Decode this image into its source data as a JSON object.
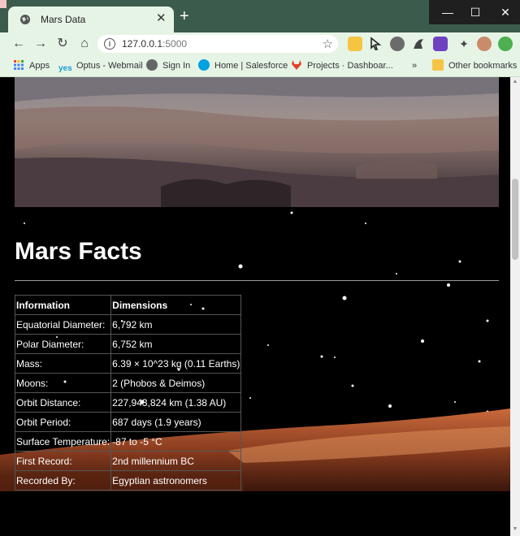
{
  "browser": {
    "tab_title": "Mars Data",
    "tab_close": "✕",
    "new_tab": "+",
    "window_controls": [
      "—",
      "☐",
      "✕"
    ],
    "url_host": "127.0.0.1",
    "url_port": ":5000",
    "bookmarks": [
      {
        "label": "Apps",
        "icon": "apps-grid-icon",
        "color": "#4285f4"
      },
      {
        "label": "Optus - Webmail",
        "icon": "optus-icon",
        "color": "#1a9bd7"
      },
      {
        "label": "Sign In",
        "icon": "globe-icon",
        "color": "#555555"
      },
      {
        "label": "Home | Salesforce",
        "icon": "salesforce-cloud-icon",
        "color": "#00a1e0"
      },
      {
        "label": "Projects · Dashboar...",
        "icon": "gitlab-fox-icon",
        "color": "#e24329"
      }
    ],
    "bookmarks_overflow": "»",
    "other_bookmarks": "Other bookmarks"
  },
  "page": {
    "heading": "Mars Facts",
    "table": {
      "headers": [
        "Information",
        "Dimensions"
      ],
      "rows": [
        [
          "Equatorial Diameter:",
          "6,792 km"
        ],
        [
          "Polar Diameter:",
          "6,752 km"
        ],
        [
          "Mass:",
          "6.39 × 10^23 kg (0.11 Earths)"
        ],
        [
          "Moons:",
          "2 (Phobos & Deimos)"
        ],
        [
          "Orbit Distance:",
          "227,943,824 km (1.38 AU)"
        ],
        [
          "Orbit Period:",
          "687 days (1.9 years)"
        ],
        [
          "Surface Temperature:",
          "-87 to -5 °C"
        ],
        [
          "First Record:",
          "2nd millennium BC"
        ],
        [
          "Recorded By:",
          "Egyptian astronomers"
        ]
      ]
    }
  },
  "colors": {
    "titlebar": "#3b5b4c",
    "toolbar": "#e6f4e6",
    "page_bg": "#000000",
    "text": "#ffffff"
  }
}
